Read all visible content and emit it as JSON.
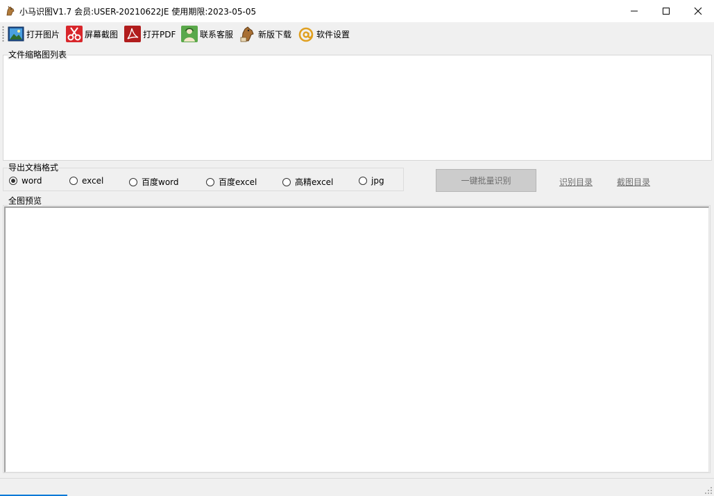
{
  "window": {
    "title": "小马识图V1.7  会员:USER-20210622JE 使用期限:2023-05-05"
  },
  "toolbar": {
    "items": [
      {
        "label": "打开图片",
        "icon": "picture-icon"
      },
      {
        "label": "屏幕截图",
        "icon": "scissors-icon"
      },
      {
        "label": "打开PDF",
        "icon": "pdf-icon"
      },
      {
        "label": "联系客服",
        "icon": "support-person-icon"
      },
      {
        "label": "新版下载",
        "icon": "horse-download-icon"
      },
      {
        "label": "软件设置",
        "icon": "at-sign-icon"
      }
    ]
  },
  "thumbnails": {
    "label": "文件缩略图列表"
  },
  "export": {
    "label": "导出文档格式",
    "options": [
      "word",
      "excel",
      "百度word",
      "百度excel",
      "高精excel",
      "jpg"
    ],
    "selected": "word"
  },
  "actions": {
    "batch_label": "一键批量识别",
    "recognize_dir_label": "识别目录",
    "screenshot_dir_label": "截图目录"
  },
  "preview": {
    "label": "全图预览"
  },
  "colors": {
    "progress": "#0078d7",
    "window_bg": "#f0f0f0"
  }
}
